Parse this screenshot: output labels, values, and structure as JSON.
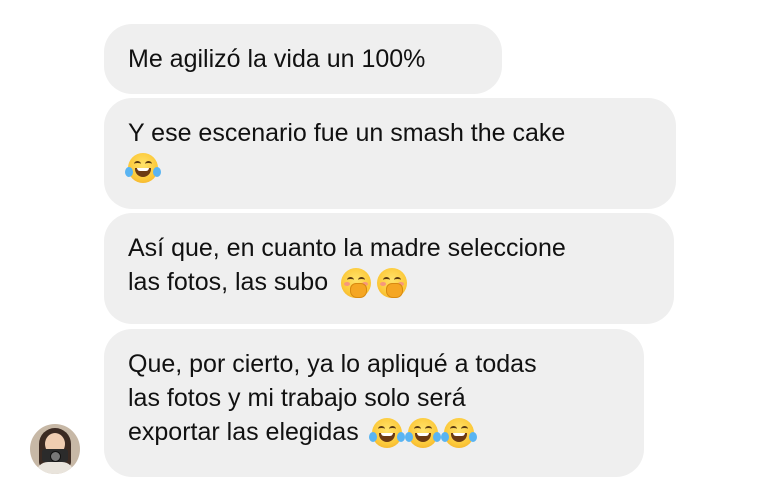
{
  "messages": [
    {
      "lines": [
        "Me agilizó la vida un 100%"
      ],
      "emojis": []
    },
    {
      "lines": [
        "Y ese escenario fue un smash the cake"
      ],
      "emojis": [
        "face-with-tears-of-joy"
      ]
    },
    {
      "lines": [
        "Así que, en cuanto la madre seleccione",
        "las fotos, las subo"
      ],
      "emojis": [
        "face-with-hand-over-mouth",
        "face-with-hand-over-mouth"
      ]
    },
    {
      "lines": [
        "Que, por cierto, ya lo apliqué a todas",
        "las fotos y mi trabajo solo será",
        "exportar las elegidas"
      ],
      "emojis": [
        "face-with-tears-of-joy",
        "face-with-tears-of-joy",
        "face-with-tears-of-joy"
      ]
    }
  ],
  "colors": {
    "bubble": "#efefef",
    "text": "#111111",
    "background": "#ffffff"
  }
}
